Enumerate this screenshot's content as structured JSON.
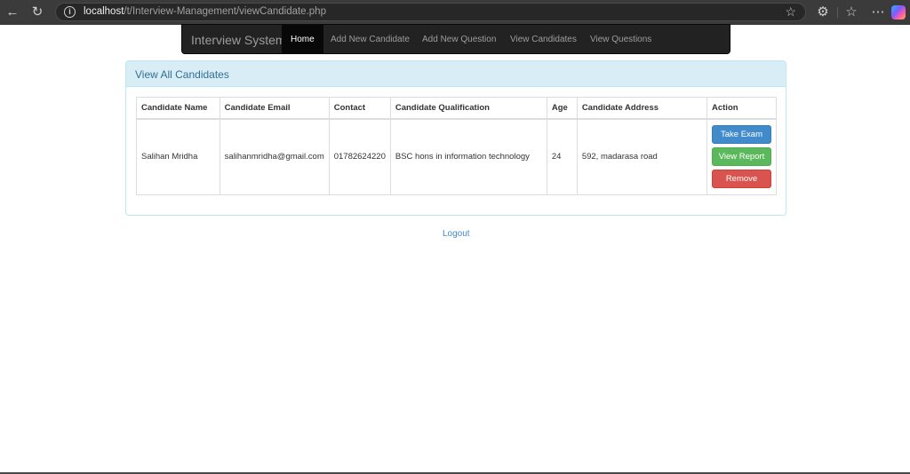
{
  "browser": {
    "url_host": "localhost",
    "url_path": "/t/Interview-Management/viewCandidate.php",
    "icons": {
      "back": "back-arrow-icon",
      "reload": "reload-icon",
      "site_info": "info-icon",
      "favorite": "star-icon",
      "extensions": "extensions-icon",
      "favorites_list": "favorites-icon",
      "more": "more-icon",
      "copilot": "copilot-icon"
    },
    "glyphs": {
      "back": "←",
      "reload": "↻",
      "info": "i",
      "star": "☆",
      "extensions": "⚙",
      "favorites": "☆",
      "more": "⋯"
    }
  },
  "navbar": {
    "brand": "Interview System",
    "items": [
      {
        "label": "Home",
        "active": true
      },
      {
        "label": "Add New Candidate",
        "active": false
      },
      {
        "label": "Add New Question",
        "active": false
      },
      {
        "label": "View Candidates",
        "active": false
      },
      {
        "label": "View Questions",
        "active": false
      }
    ]
  },
  "panel": {
    "title": "View All Candidates",
    "table": {
      "headers": [
        "Candidate Name",
        "Candidate Email",
        "Contact",
        "Candidate Qualification",
        "Age",
        "Candidate Address",
        "Action"
      ],
      "rows": [
        {
          "name": "Salihan Mridha",
          "email": "salihanmridha@gmail.com",
          "contact": "01782624220",
          "qualification": "BSC hons in information technology",
          "age": "24",
          "address": "592, madarasa road",
          "actions": [
            "Take Exam",
            "View Report",
            "Remove"
          ]
        }
      ]
    }
  },
  "footer": {
    "logout": "Logout"
  },
  "colors": {
    "navbar_bg": "#222222",
    "panel_heading_bg": "#d9edf7",
    "panel_heading_text": "#31708f",
    "primary": "#428bca",
    "success": "#5cb85c",
    "danger": "#d9534f",
    "link": "#428bca"
  }
}
